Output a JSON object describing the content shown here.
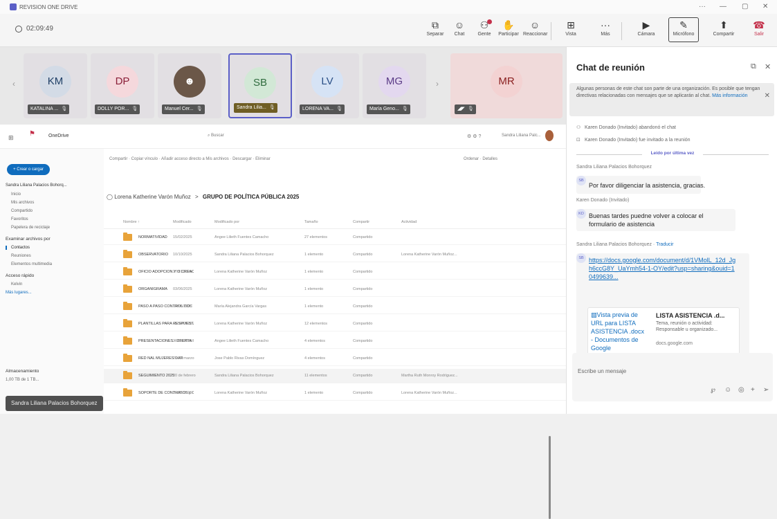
{
  "window": {
    "title": "REVISION ONE DRIVE",
    "minimize": "···",
    "min": "—",
    "max": "▢",
    "close": "✕"
  },
  "meeting": {
    "timer": "02:09:49"
  },
  "toolbar": {
    "items": [
      {
        "label": "Separar",
        "icon": "⧉"
      },
      {
        "label": "Chat",
        "icon": "☺"
      },
      {
        "label": "Gente",
        "icon": "⚇"
      },
      {
        "label": "Participar",
        "icon": "✋"
      },
      {
        "label": "Reaccionar",
        "icon": "☺"
      },
      {
        "label": "Vista",
        "icon": "⊞"
      },
      {
        "label": "Más",
        "icon": "···"
      },
      {
        "label": "Cámara",
        "icon": "▶"
      },
      {
        "label": "Micrófono",
        "icon": "✎"
      },
      {
        "label": "Compartir",
        "icon": "⬆"
      },
      {
        "label": "Salir",
        "icon": "☎"
      }
    ]
  },
  "gallery": {
    "participants": [
      {
        "initials": "KM",
        "name": "KATALINA ...",
        "bg": "#d3dbe6",
        "color": "#1f3f66"
      },
      {
        "initials": "DP",
        "name": "DOLLY POR...",
        "bg": "#f5d8dc",
        "color": "#8a1f38"
      },
      {
        "initials": "",
        "name": "Manuel Cer...",
        "bg": "#6b5748",
        "color": "#fff"
      },
      {
        "initials": "SB",
        "name": "Sandra Lilia...",
        "bg": "#d2e8d6",
        "color": "#2f6b3e"
      },
      {
        "initials": "LV",
        "name": "LORENA VA...",
        "bg": "#d6e3f5",
        "color": "#2a4f86"
      },
      {
        "initials": "MG",
        "name": "María Geno...",
        "bg": "#e3d8ef",
        "color": "#5a3a86"
      }
    ],
    "overflow": {
      "initials": "MR",
      "bg": "#f3d2d2",
      "color": "#8a2020"
    }
  },
  "onedrive": {
    "app": "OneDrive",
    "search_placeholder": "Buscar",
    "user": "Sandra Liliana Palc...",
    "new_button": "+ Crear o cargar",
    "toolbar": "Compartir · Copiar vínculo · Añadir acceso directo a Mis archivos · Descargar · Eliminar",
    "sort": "Ordenar · Detalles",
    "sidebar": {
      "user": "Sandra Liliana Palacios Bohorq...",
      "items": [
        "Inicio",
        "Mis archivos",
        "Compartido",
        "Favoritos",
        "Papelera de reciclaje"
      ],
      "browse_head": "Examinar archivos por",
      "browse": [
        "Contactos",
        "Reuniones",
        "Elementos multimedia"
      ],
      "quick_head": "Acceso rápido",
      "quick": [
        "Kelvin",
        "Más lugares..."
      ],
      "storage_head": "Almacenamiento",
      "storage": "1,00 TB de 1 TB..."
    },
    "breadcrumb": {
      "owner": "Lorena Katherine Varón Muñoz",
      "sep": ">",
      "folder": "GRUPO DE POLÍTICA PÚBLICA 2025"
    },
    "columns": [
      "Nombre ↑",
      "Modificado",
      "Modificado por",
      "Tamaño",
      "Compartir",
      "Actividad"
    ],
    "rows": [
      {
        "name": "NORMATIVIDAD",
        "mod": "15/02/2025",
        "by": "Angee Lilieth Fuentes Camacho",
        "size": "27 elementos",
        "share": "Compartido",
        "act": ""
      },
      {
        "name": "OBSERVATORIO",
        "mod": "10/10/2025",
        "by": "Sandra Liliana Palacios Bohorquez",
        "size": "1 elemento",
        "share": "Compartido",
        "act": "Lorena Katherine Varón Muñoz..."
      },
      {
        "name": "OFICIO ADOPCIÓN Y O CREACIÓN POLITICA P...",
        "mod": "27/01/2025",
        "by": "Lorena Katherine Varón Muñoz",
        "size": "1 elemento",
        "share": "Compartido",
        "act": ""
      },
      {
        "name": "ORGANIGRAMA",
        "mod": "03/06/2025",
        "by": "Lorena Katherine Varón Muñoz",
        "size": "1 elemento",
        "share": "Compartido",
        "act": ""
      },
      {
        "name": "PASO A PASO CONTROL DOC",
        "mod": "14/05/2025",
        "by": "María Alejandra García Vargas",
        "size": "1 elemento",
        "share": "Compartido",
        "act": ""
      },
      {
        "name": "PLANTILLAS PARA RESPUESTAS OFICIALES",
        "mod": "05/10/2025",
        "by": "Lorena Katherine Varón Muñoz",
        "size": "12 elementos",
        "share": "Compartido",
        "act": ""
      },
      {
        "name": "PRESENTACIONES - OFERTA INSTITUCIONA... 2025",
        "mod": "20/05/2025",
        "by": "Angee Lilieth Fuentes Camacho",
        "size": "4 elementos",
        "share": "Compartido",
        "act": ""
      },
      {
        "name": "RED NAL MUJERES DAR",
        "mod": "29 de marzo",
        "by": "Jose Pablo Rivas Domínguez",
        "size": "4 elementos",
        "share": "Compartido",
        "act": ""
      },
      {
        "name": "SEGUIMIENTO 2025",
        "mod": "20 de febrero",
        "by": "Sandra Liliana Palacios Bohorquez",
        "size": "11 elementos",
        "share": "Compartido",
        "act": "Martha Ruth Monroy Rodríguez..."
      },
      {
        "name": "SOPORTE DE CONTRATOS y CTAS DE COBRO 2...",
        "mod": "25/05/2025",
        "by": "Lorena Katherine Varón Muñoz",
        "size": "1 elemento",
        "share": "Compartido",
        "act": "Lorena Katherine Varón Muñoz..."
      }
    ]
  },
  "presenter_tag": "Sandra Liliana Palacios Bohorquez",
  "chat": {
    "title": "Chat de reunión",
    "banner_text": "Algunas personas de este chat son parte de una organización. Es posible que tengan directivas relacionadas con mensajes que se aplicarán al chat.",
    "banner_link": "Más información",
    "sys1": "Karen Donado (Invitado) abandonó el chat",
    "sys2": "Karen Donado (Invitado) fue invitado a la reunión",
    "read": "Leído por última vez",
    "m1_sender": "Sandra Liliana Palacios Bohorquez",
    "m1_av": "SB",
    "m1_text": "Por favor diligenciar la asistencia, gracias.",
    "m2_sender": "Karen Donado (Invitado)",
    "m2_av": "KD",
    "m2_text": "Buenas tardes puedne volver a colocar el formulario de asistencia",
    "m3_sender": "Sandra Liliana Palacios Bohorquez",
    "m3_translate": "Traducir",
    "m3_av": "SB",
    "m3_link": "https://docs.google.com/document/d/1VMolL_12d_Jgh6ccG8Y_UaYmh54-1-OY/edit?usp=sharing&ouid=10499639...",
    "preview_img": "Vista previa de URL para LISTA ASISTENCIA .docx - Documentos de Google",
    "preview_title": "LISTA ASISTENCIA .d...",
    "preview_desc": "Tema, reunión o actividad: Responsable u organizado...",
    "preview_domain": "docs.google.com",
    "compose_placeholder": "Escribe un mensaje"
  }
}
